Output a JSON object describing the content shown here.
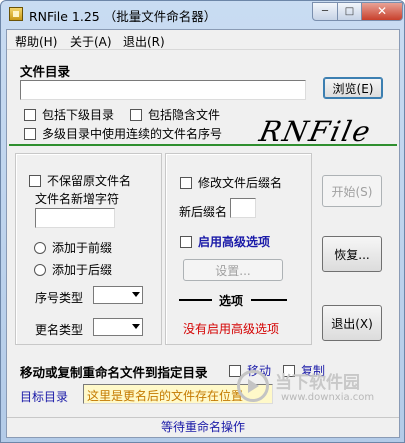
{
  "window": {
    "title": "RNFile 1.25 （批量文件命名器）",
    "controls": {
      "minimize": "─",
      "maximize": "□",
      "close": "✕"
    }
  },
  "menu": {
    "items": [
      "帮助(H)",
      "关于(A)",
      "退出(R)"
    ]
  },
  "file_dir": {
    "heading": "文件目录",
    "path_value": "",
    "browse_label": "浏览(E)",
    "include_subdirs": "包括下级目录",
    "include_hidden": "包括隐含文件",
    "continuous_seq": "多级目录中使用连续的文件名序号"
  },
  "logo_text": "RNFile",
  "name_options": {
    "no_keep_original": "不保留原文件名",
    "new_chars_label": "文件名新增字符",
    "new_chars_value": "",
    "add_prefix": "添加于前缀",
    "add_suffix": "添加于后缀",
    "seq_type_label": "序号类型",
    "rename_type_label": "更名类型"
  },
  "ext_options": {
    "modify_ext": "修改文件后缀名",
    "new_ext_label": "新后缀名",
    "new_ext_value": "",
    "enable_advanced": "启用高级选项",
    "settings_label": "设置...",
    "options_heading": "选项",
    "advanced_status": "没有启用高级选项"
  },
  "actions": {
    "start_label": "开始(S)",
    "restore_label": "恢复...",
    "exit_label": "退出(X)"
  },
  "move_copy": {
    "heading": "移动或复制重命名文件到指定目录",
    "move_label": "移动",
    "copy_label": "复制",
    "target_label": "目标目录",
    "target_value": "这里是更名后的文件存在位置"
  },
  "status": "等待重命名操作",
  "watermark": {
    "text": "当下软件园",
    "url": "www.downxia.com"
  },
  "colors": {
    "accent_blue": "#1a1aa8",
    "warning_red": "#d40000",
    "target_field_bg": "#fff9c9",
    "target_field_text": "#c47a00",
    "separator_green": "#2f8f2f"
  }
}
